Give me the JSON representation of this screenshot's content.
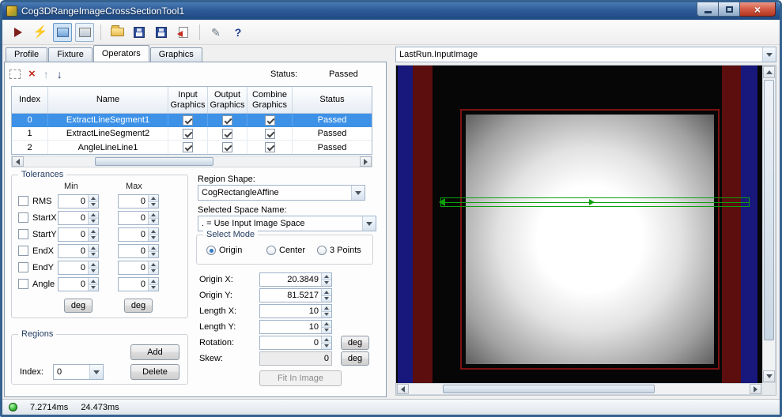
{
  "window": {
    "title": "Cog3DRangeImageCrossSectionTool1"
  },
  "toolbar": {
    "help_label": "?"
  },
  "tabs": {
    "items": [
      "Profile",
      "Fixture",
      "Operators",
      "Graphics"
    ],
    "active": "Operators"
  },
  "operators": {
    "status_label": "Status:",
    "status_value": "Passed",
    "table": {
      "headers": {
        "index": "Index",
        "name": "Name",
        "input": "Input\nGraphics",
        "output": "Output\nGraphics",
        "combine": "Combine\nGraphics",
        "status": "Status"
      },
      "rows": [
        {
          "index": "0",
          "name": "ExtractLineSegment1",
          "input_checked": true,
          "output_checked": true,
          "combine_checked": true,
          "status": "Passed",
          "selected": true
        },
        {
          "index": "1",
          "name": "ExtractLineSegment2",
          "input_checked": true,
          "output_checked": true,
          "combine_checked": true,
          "status": "Passed",
          "selected": false
        },
        {
          "index": "2",
          "name": "AngleLineLine1",
          "input_checked": true,
          "output_checked": true,
          "combine_checked": true,
          "status": "Passed",
          "selected": false
        }
      ]
    }
  },
  "tolerances": {
    "title": "Tolerances",
    "min_label": "Min",
    "max_label": "Max",
    "deg_label": "deg",
    "rows": [
      {
        "label": "RMS",
        "min": "0",
        "max": "0"
      },
      {
        "label": "StartX",
        "min": "0",
        "max": "0"
      },
      {
        "label": "StartY",
        "min": "0",
        "max": "0"
      },
      {
        "label": "EndX",
        "min": "0",
        "max": "0"
      },
      {
        "label": "EndY",
        "min": "0",
        "max": "0"
      },
      {
        "label": "Angle",
        "min": "0",
        "max": "0"
      }
    ]
  },
  "region": {
    "shape_label": "Region Shape:",
    "shape_value": "CogRectangleAffine",
    "space_label": "Selected Space Name:",
    "space_value": ". = Use Input Image Space",
    "mode": {
      "title": "Select Mode",
      "options": [
        "Origin",
        "Center",
        "3 Points"
      ],
      "selected": "Origin"
    },
    "fields": [
      {
        "label": "Origin X:",
        "value": "20.3849"
      },
      {
        "label": "Origin Y:",
        "value": "81.5217"
      },
      {
        "label": "Length X:",
        "value": "10"
      },
      {
        "label": "Length Y:",
        "value": "10"
      },
      {
        "label": "Rotation:",
        "value": "0"
      },
      {
        "label": "Skew:",
        "value": "0"
      }
    ],
    "deg_label": "deg",
    "fit_button": "Fit In Image"
  },
  "regions": {
    "title": "Regions",
    "add_button": "Add",
    "index_label": "Index:",
    "index_value": "0",
    "delete_button": "Delete"
  },
  "display": {
    "source": "LastRun.InputImage"
  },
  "status_bar": {
    "time_1": "7.2714ms",
    "time_2": "24.473ms"
  }
}
